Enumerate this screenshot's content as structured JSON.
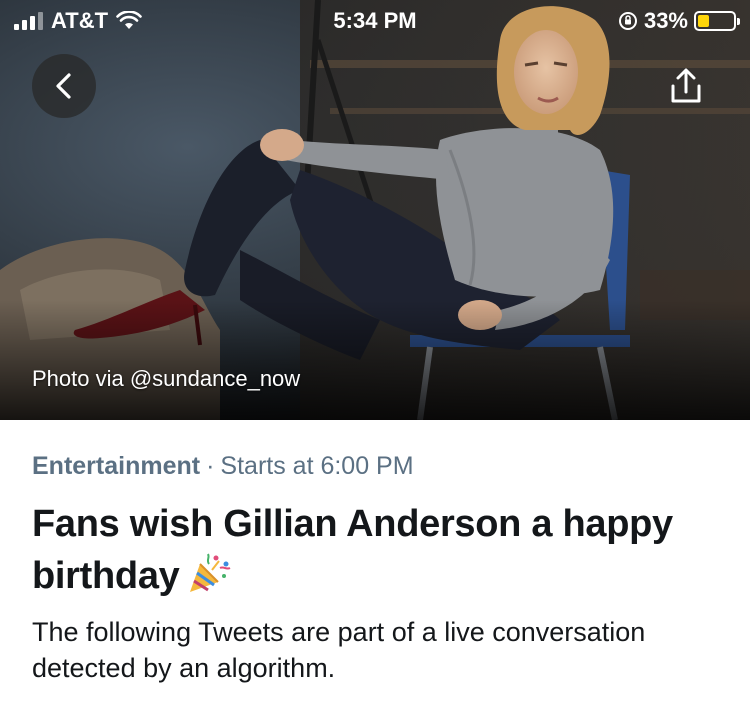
{
  "status_bar": {
    "carrier": "AT&T",
    "time": "5:34 PM",
    "battery_percent": "33%",
    "battery_level": 0.33,
    "battery_color": "#ffd60a"
  },
  "hero": {
    "photo_credit": "Photo via @sundance_now",
    "back_icon": "chevron-left-icon",
    "share_icon": "share-icon"
  },
  "event": {
    "category": "Entertainment",
    "separator": "·",
    "start_time": "Starts at 6:00 PM",
    "headline": "Fans wish Gillian Anderson a happy birthday",
    "headline_emoji": "party-popper-icon",
    "description": "The following Tweets are part of a live conversation detected by an algorithm."
  },
  "colors": {
    "secondary_text": "#5b7083",
    "primary_text": "#14171a"
  }
}
